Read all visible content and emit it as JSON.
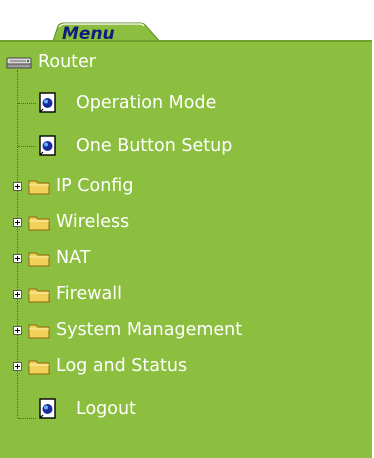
{
  "menu": {
    "tab_label": "Menu",
    "root": {
      "label": "Router",
      "icon": "router-icon"
    },
    "items": [
      {
        "label": "Operation Mode",
        "icon": "page-icon",
        "type": "page"
      },
      {
        "label": "One Button Setup",
        "icon": "page-icon",
        "type": "page"
      },
      {
        "label": "IP Config",
        "icon": "folder-icon",
        "type": "folder",
        "expander": "plus"
      },
      {
        "label": "Wireless",
        "icon": "folder-icon",
        "type": "folder",
        "expander": "plus"
      },
      {
        "label": "NAT",
        "icon": "folder-icon",
        "type": "folder",
        "expander": "plus"
      },
      {
        "label": "Firewall",
        "icon": "folder-icon",
        "type": "folder",
        "expander": "plus"
      },
      {
        "label": "System Management",
        "icon": "folder-icon",
        "type": "folder",
        "expander": "plus"
      },
      {
        "label": "Log and Status",
        "icon": "folder-icon",
        "type": "folder",
        "expander": "plus"
      },
      {
        "label": "Logout",
        "icon": "page-icon",
        "type": "page"
      }
    ]
  },
  "colors": {
    "panel": "#8cbf3f",
    "tab": "#8cbf3f",
    "tab_text": "#101c7a",
    "text": "#ffffff"
  }
}
